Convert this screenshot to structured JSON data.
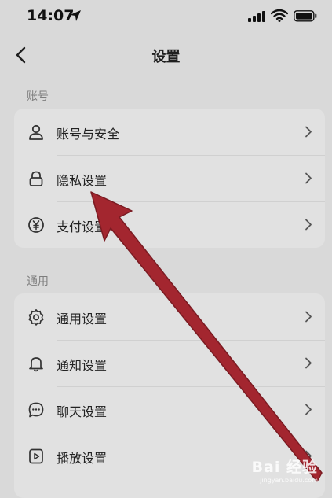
{
  "status_bar": {
    "time": "14:07"
  },
  "nav": {
    "title": "设置"
  },
  "sections": [
    {
      "label": "账号",
      "items": [
        {
          "icon": "user-icon",
          "label": "账号与安全"
        },
        {
          "icon": "lock-icon",
          "label": "隐私设置"
        },
        {
          "icon": "yuan-icon",
          "label": "支付设置"
        }
      ]
    },
    {
      "label": "通用",
      "items": [
        {
          "icon": "gear-icon",
          "label": "通用设置"
        },
        {
          "icon": "bell-icon",
          "label": "通知设置"
        },
        {
          "icon": "chat-bubble-icon",
          "label": "聊天设置"
        },
        {
          "icon": "play-icon",
          "label": "播放设置"
        }
      ]
    }
  ],
  "watermark": {
    "text": "Bai 经验",
    "sub": "jingyan.baidu.com"
  }
}
